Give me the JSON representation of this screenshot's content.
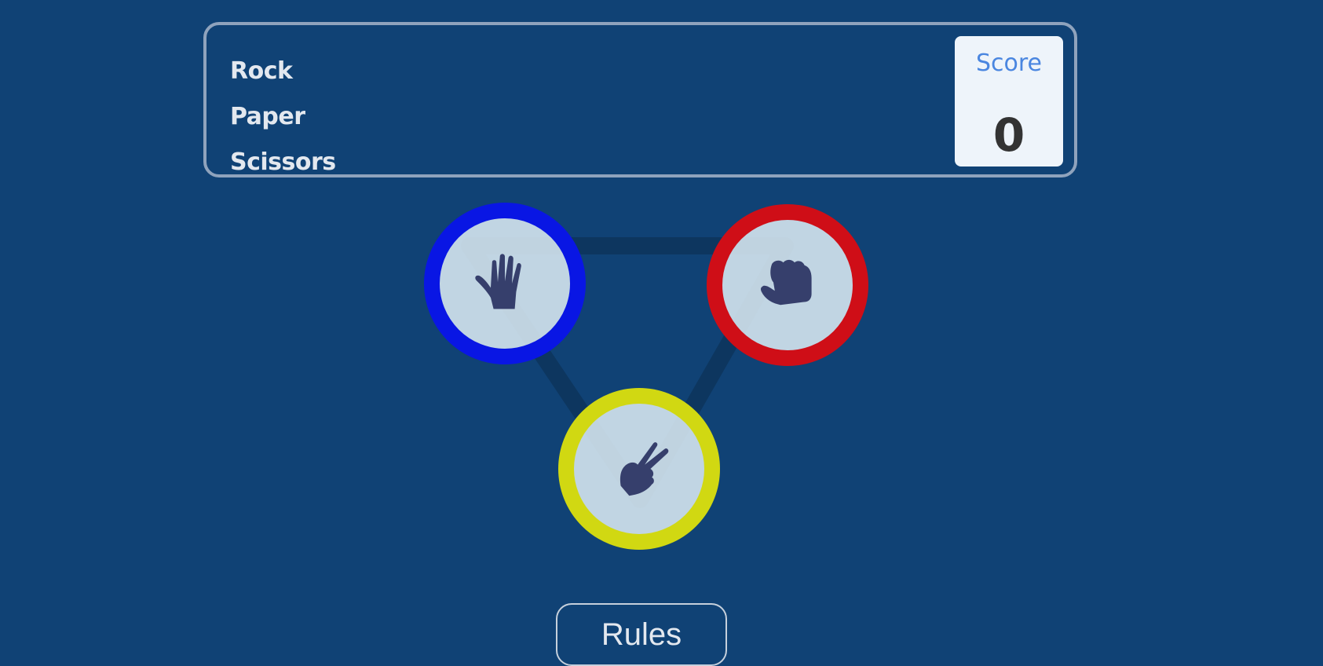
{
  "header": {
    "titles": [
      "Rock",
      "Paper",
      "Scissors"
    ]
  },
  "score": {
    "label": "Score",
    "value": "0"
  },
  "choices": [
    {
      "name": "paper",
      "icon": "paper-hand-icon",
      "ring_color": "#0916e4"
    },
    {
      "name": "rock",
      "icon": "rock-fist-icon",
      "ring_color": "#cf0e17"
    },
    {
      "name": "scissors",
      "icon": "scissors-hand-icon",
      "ring_color": "#d1d812"
    }
  ],
  "colors": {
    "background": "#104275",
    "header_border": "#8fa3bd",
    "score_label": "#4a86e0",
    "icon_fill": "#363f6c"
  },
  "rules_button": {
    "label": "Rules"
  }
}
